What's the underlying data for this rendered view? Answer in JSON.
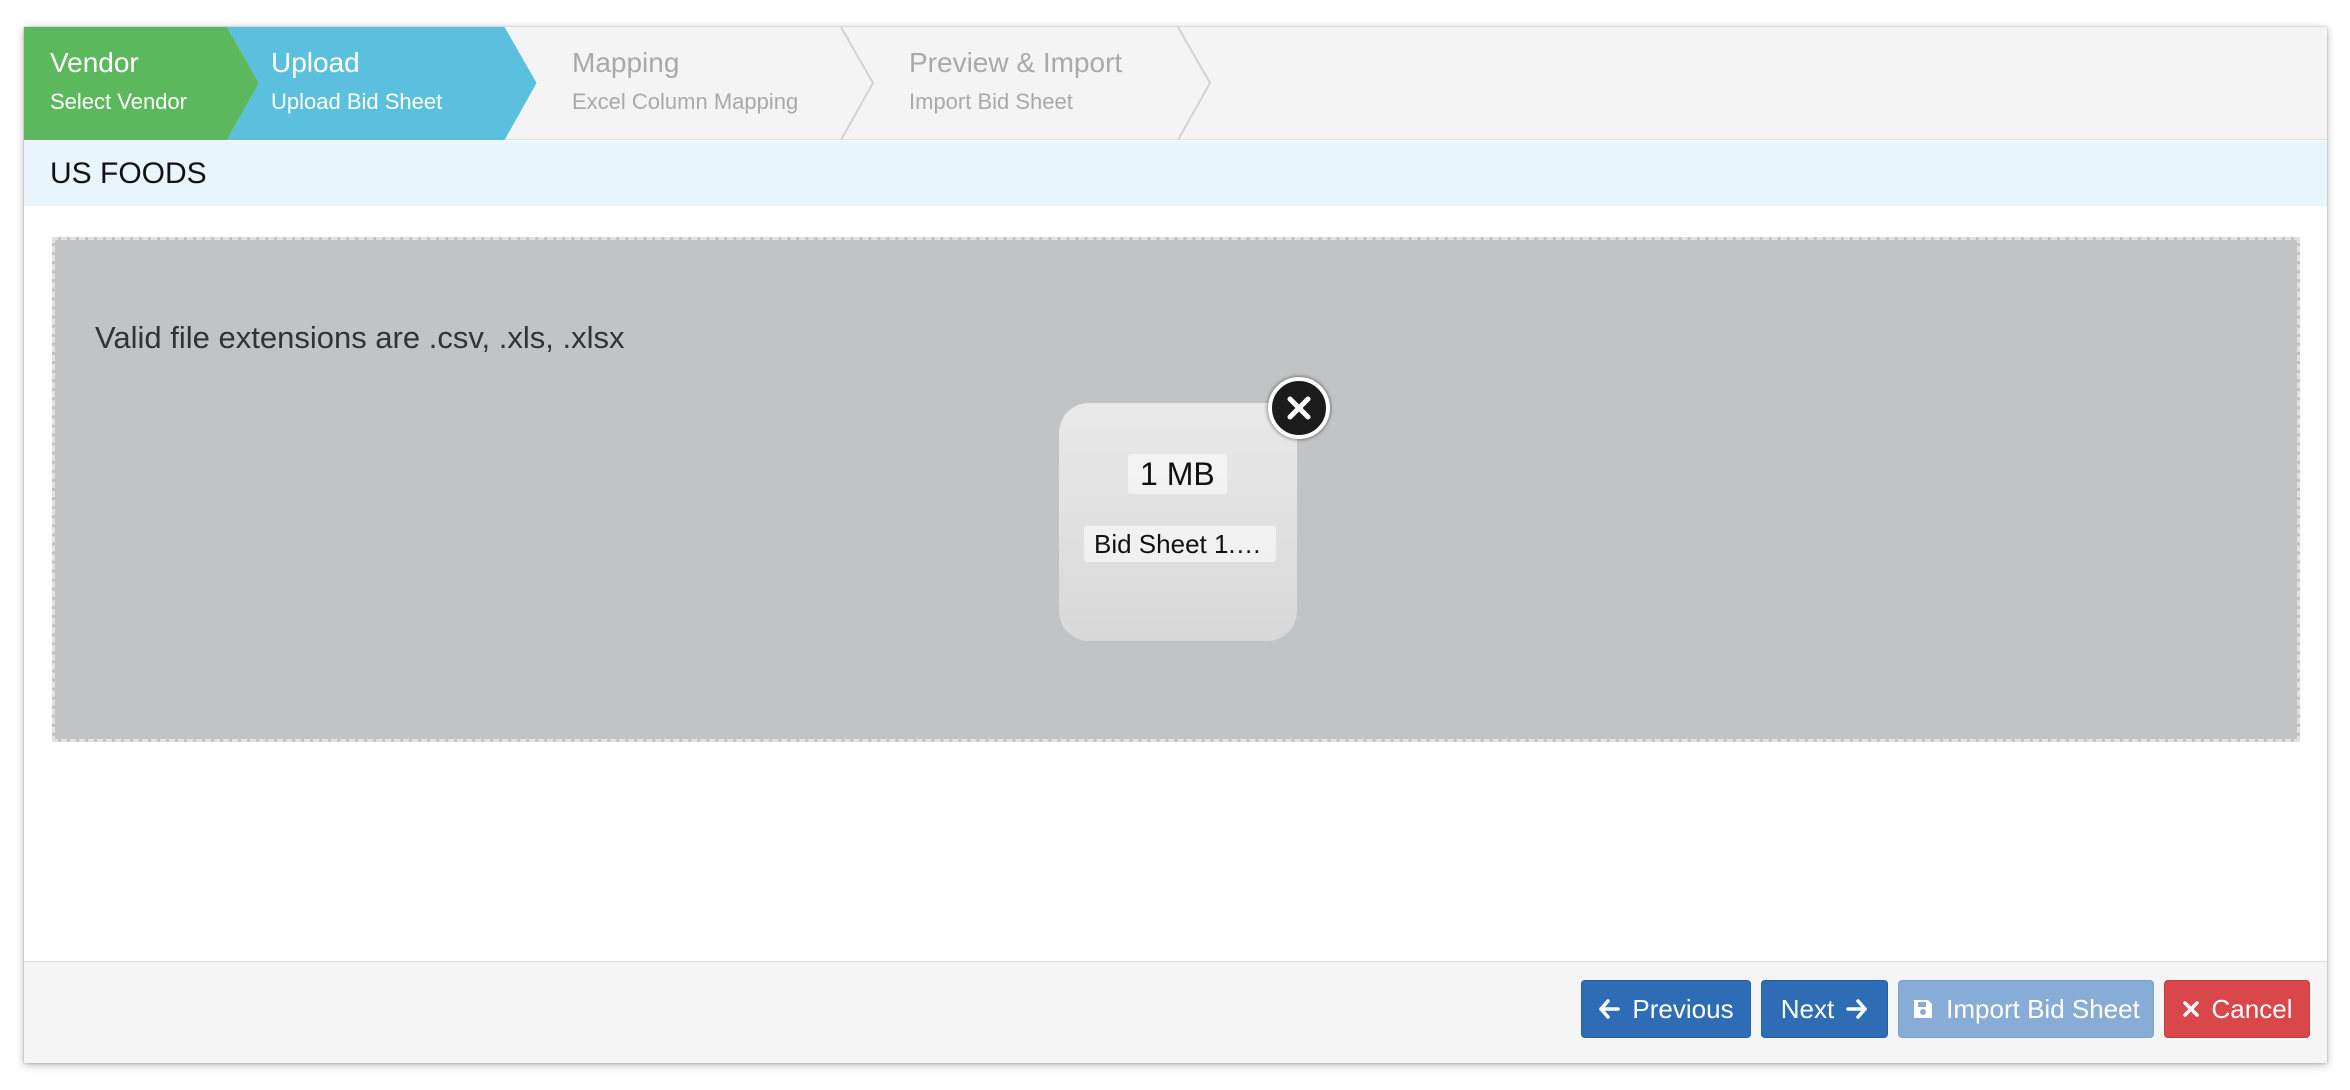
{
  "wizard": {
    "steps": [
      {
        "title": "Vendor",
        "subtitle": "Select Vendor",
        "state": "done"
      },
      {
        "title": "Upload",
        "subtitle": "Upload Bid Sheet",
        "state": "active"
      },
      {
        "title": "Mapping",
        "subtitle": "Excel Column Mapping",
        "state": "todo"
      },
      {
        "title": "Preview & Import",
        "subtitle": "Import Bid Sheet",
        "state": "todo"
      }
    ],
    "colors": {
      "done": "#5cb85c",
      "active": "#5bc0de",
      "todo": "#f4f4f4"
    }
  },
  "vendor": {
    "name": "US FOODS"
  },
  "dropzone": {
    "message": "Valid file extensions are .csv, .xls, .xlsx",
    "file": {
      "size": "1 MB",
      "name": "Bid Sheet 1.xl…"
    },
    "remove_icon": "close-circle-icon"
  },
  "footer": {
    "previous_label": "Previous",
    "next_label": "Next",
    "import_label": "Import Bid Sheet",
    "cancel_label": "Cancel",
    "icons": {
      "previous": "arrow-left-icon",
      "next": "arrow-right-icon",
      "import": "save-icon",
      "cancel": "times-icon"
    }
  }
}
